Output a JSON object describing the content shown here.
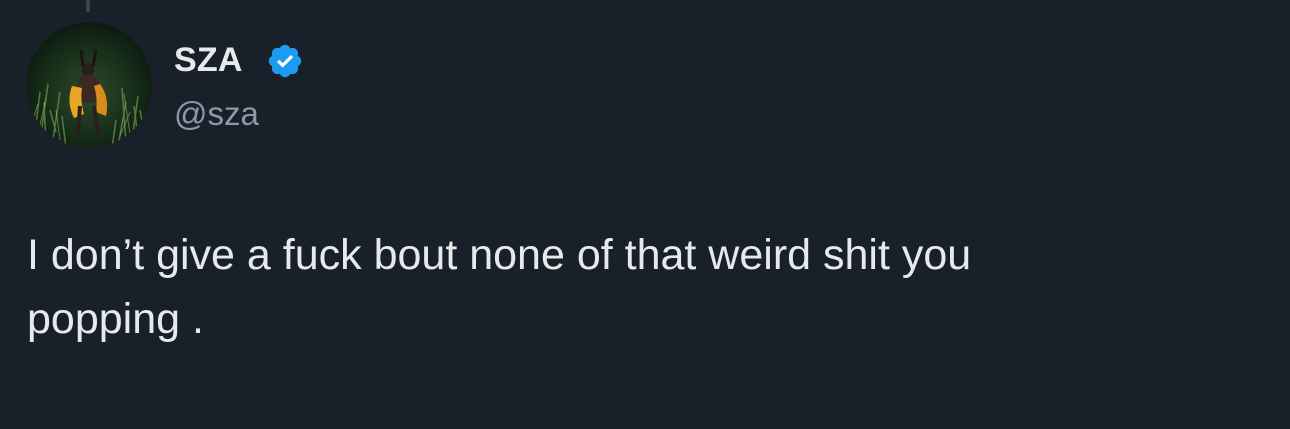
{
  "author": {
    "display_name": "SZA",
    "handle": "@sza",
    "verified": true,
    "avatar_icon": "profile-avatar-icon",
    "badge_icon": "verified-badge-icon"
  },
  "tweet": {
    "text": "I don’t give a fuck bout none of that weird shit you\npopping ."
  },
  "colors": {
    "background": "#18202a",
    "primary_text": "#e7e9ea",
    "secondary_text": "#8b98a5",
    "verified_blue": "#1d9bf0"
  }
}
